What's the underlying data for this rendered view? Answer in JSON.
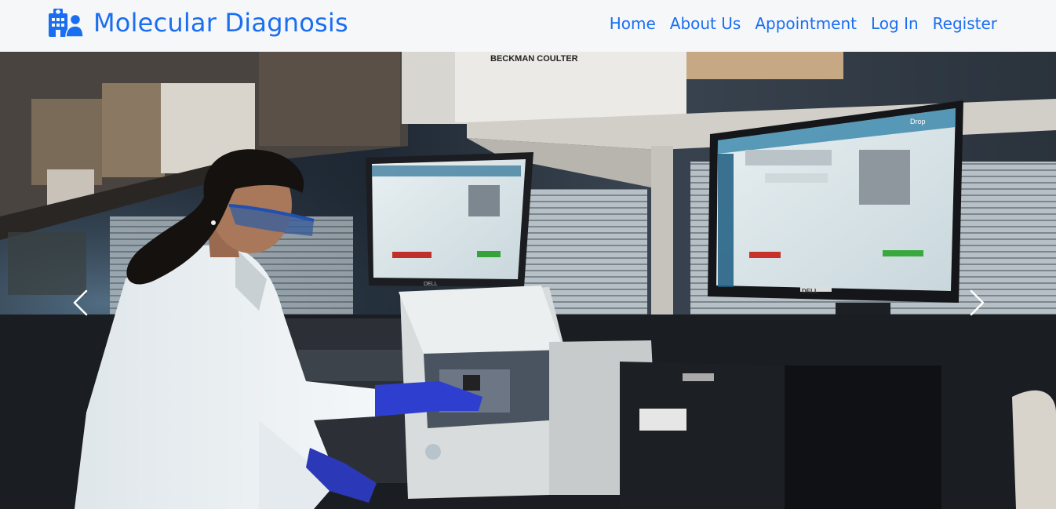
{
  "brand": {
    "name": "Molecular Diagnosis",
    "icon": "hospital-user-icon",
    "color": "#1a6ef0"
  },
  "nav": {
    "items": [
      {
        "label": "Home"
      },
      {
        "label": "About Us"
      },
      {
        "label": "Appointment"
      },
      {
        "label": "Log In"
      },
      {
        "label": "Register"
      }
    ]
  },
  "carousel": {
    "prev_icon": "chevron-left-icon",
    "next_icon": "chevron-right-icon",
    "slide": {
      "box_label_top": "BECKMAN COULTER",
      "monitor_brand": "DELL",
      "monitor_app_title": "Drop"
    }
  }
}
